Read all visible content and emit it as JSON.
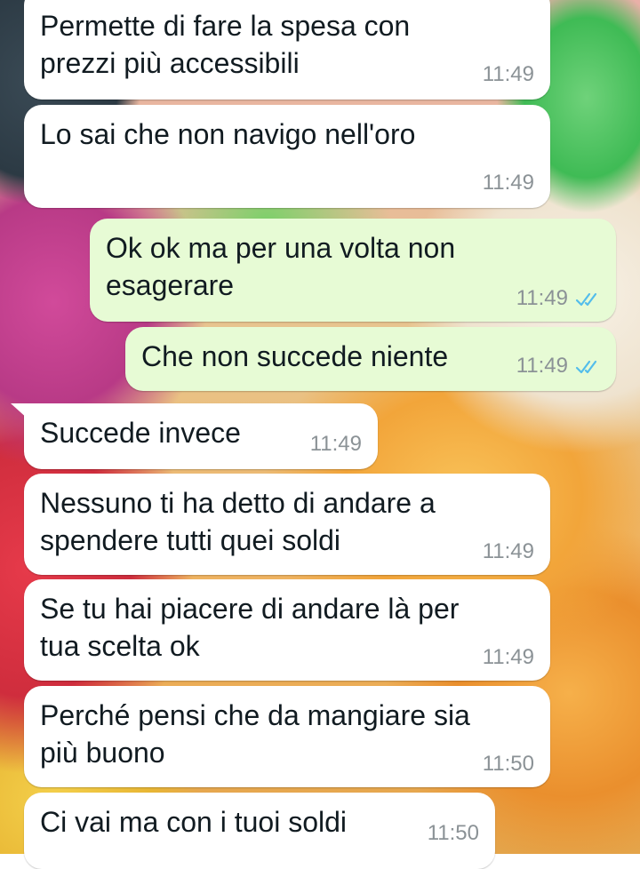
{
  "messages": [
    {
      "id": "m1",
      "direction": "in",
      "text": "Permette di fare la spesa con\nprezzi più accessibili",
      "time": "11:49"
    },
    {
      "id": "m2",
      "direction": "in",
      "text": "Lo sai che non navigo nell'oro",
      "time": "11:49"
    },
    {
      "id": "m3",
      "direction": "out",
      "text": "Ok ok ma per una volta non\nesagerare",
      "time": "11:49",
      "status": "read"
    },
    {
      "id": "m4",
      "direction": "out",
      "text": "Che non succede niente",
      "time": "11:49",
      "status": "read"
    },
    {
      "id": "m5",
      "direction": "in",
      "text": "Succede invece",
      "time": "11:49"
    },
    {
      "id": "m6",
      "direction": "in",
      "text": "Nessuno ti ha detto di andare a\nspendere tutti quei soldi",
      "time": "11:49"
    },
    {
      "id": "m7",
      "direction": "in",
      "text": "Se tu hai piacere di andare là per\ntua scelta ok",
      "time": "11:49"
    },
    {
      "id": "m8",
      "direction": "in",
      "text": "Perché pensi che da mangiare sia\npiù buono",
      "time": "11:50"
    },
    {
      "id": "m9",
      "direction": "in",
      "text": "Ci vai ma con i tuoi soldi",
      "time": "11:50"
    }
  ],
  "colors": {
    "incoming_bubble": "#ffffff",
    "outgoing_bubble": "#e7fbd5",
    "timestamp": "#8b9296",
    "read_ticks": "#53bdeb"
  },
  "icons": {
    "read_status": "double-check-icon"
  }
}
